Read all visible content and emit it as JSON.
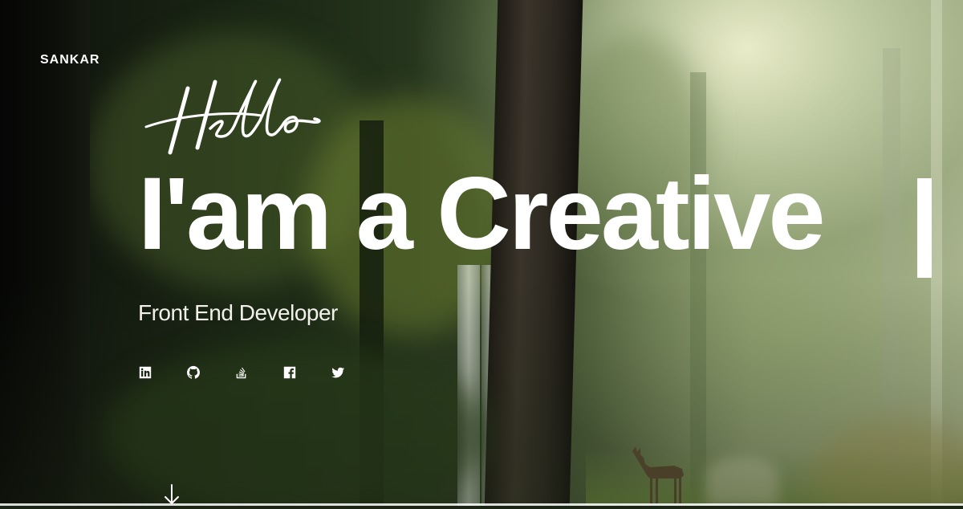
{
  "brand": {
    "name": "SANKAR"
  },
  "hero": {
    "greeting": "Hello",
    "headline": "I'am a Creative",
    "subtitle": "Front End Developer"
  },
  "socials": [
    {
      "icon": "linkedin-icon"
    },
    {
      "icon": "github-icon"
    },
    {
      "icon": "stackoverflow-icon"
    },
    {
      "icon": "facebook-icon"
    },
    {
      "icon": "twitter-icon"
    }
  ],
  "scroll": {
    "icon": "arrow-down-icon"
  },
  "colors": {
    "text": "#ffffff",
    "forest_dark": "#0a0d08",
    "light_glow": "#eef0cd"
  }
}
